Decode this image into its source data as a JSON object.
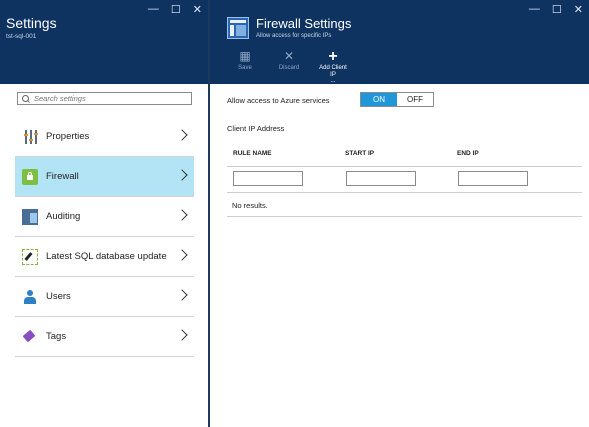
{
  "left": {
    "title": "Settings",
    "subtitle": "tst-sql-001",
    "window_controls": [
      "—",
      "☐",
      "✕"
    ],
    "search": {
      "placeholder": "Search settings"
    },
    "menu": [
      {
        "label": "Properties",
        "icon": "properties-icon"
      },
      {
        "label": "Firewall",
        "icon": "firewall-icon",
        "selected": true
      },
      {
        "label": "Auditing",
        "icon": "auditing-icon"
      },
      {
        "label": "Latest SQL database update",
        "icon": "update-icon"
      },
      {
        "label": "Users",
        "icon": "users-icon"
      },
      {
        "label": "Tags",
        "icon": "tag-icon"
      }
    ]
  },
  "right": {
    "title": "Firewall Settings",
    "subtitle": "Allow access for specific IPs",
    "window_controls": [
      "—",
      "☐",
      "✕"
    ],
    "toolbar": {
      "save": {
        "icon": "💾",
        "label": "Save"
      },
      "discard": {
        "icon": "✕",
        "label": "Discard"
      },
      "add_client_ip": {
        "icon": "+",
        "label": "Add Client IP",
        "more": "..."
      }
    },
    "allow_azure_label": "Allow access to Azure services",
    "toggle": {
      "on": "ON",
      "off": "OFF",
      "value": "ON"
    },
    "client_ip_label": "Client IP Address",
    "table": {
      "headers": [
        "RULE NAME",
        "START IP",
        "END IP"
      ],
      "empty_text": "No results."
    }
  },
  "colors": {
    "header_bg": "#0f3361",
    "selected_bg": "#b2e4f6",
    "toggle_on": "#1f97d8"
  }
}
